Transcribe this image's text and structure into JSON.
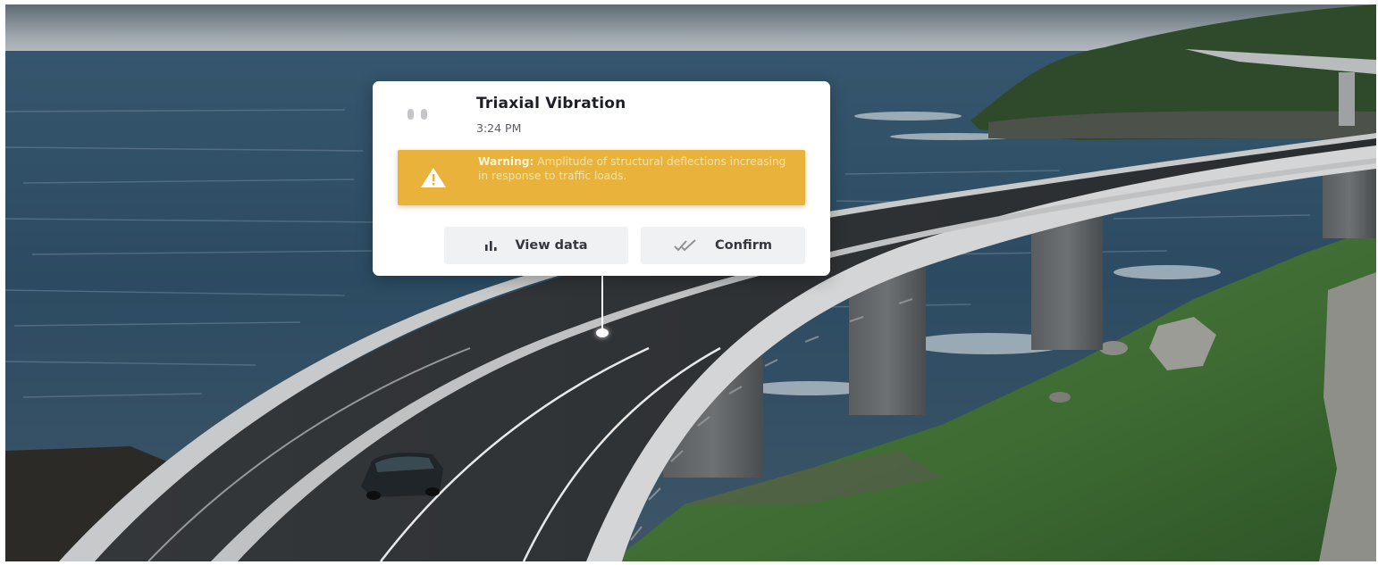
{
  "alert": {
    "title": "Triaxial Vibration",
    "time": "3:24 PM",
    "sensor_icon": "vibration-sensor-icon",
    "warning": {
      "icon": "warning-triangle-icon",
      "label": "Warning:",
      "message": "Amplitude of structural deflections increasing in response to traffic loads."
    },
    "actions": {
      "view_data_label": "View data",
      "view_data_icon": "bar-chart-icon",
      "confirm_label": "Confirm",
      "confirm_icon": "double-check-icon"
    }
  },
  "colors": {
    "warning": "#e9b23a",
    "card": "#ffffff",
    "button": "#f0f1f3"
  }
}
